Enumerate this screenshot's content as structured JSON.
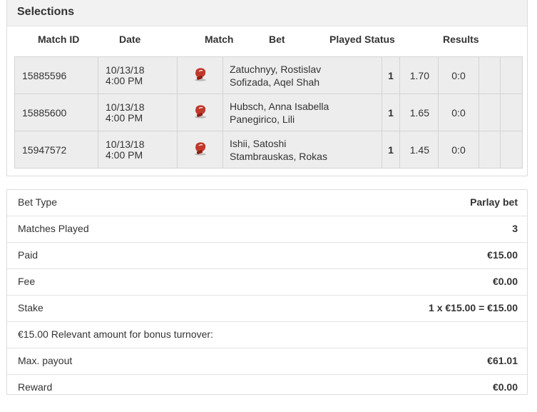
{
  "selections": {
    "title": "Selections",
    "headers": {
      "match_id": "Match ID",
      "date": "Date",
      "match": "Match",
      "bet": "Bet",
      "played_status": "Played Status",
      "results": "Results"
    },
    "rows": [
      {
        "id": "15885596",
        "date": "10/13/18",
        "time": "4:00 PM",
        "sport_icon": "boxing-glove-icon",
        "player1": "Zatuchnyy, Rostislav",
        "player2": "Sofizada, Aqel Shah",
        "bet": "1",
        "odds": "1.70",
        "result": "0:0"
      },
      {
        "id": "15885600",
        "date": "10/13/18",
        "time": "4:00 PM",
        "sport_icon": "boxing-glove-icon",
        "player1": "Hubsch, Anna Isabella",
        "player2": "Panegirico, Lili",
        "bet": "1",
        "odds": "1.65",
        "result": "0:0"
      },
      {
        "id": "15947572",
        "date": "10/13/18",
        "time": "4:00 PM",
        "sport_icon": "boxing-glove-icon",
        "player1": "Ishii, Satoshi",
        "player2": "Stambrauskas, Rokas",
        "bet": "1",
        "odds": "1.45",
        "result": "0:0"
      }
    ]
  },
  "summary": [
    {
      "label": "Bet Type",
      "value": "Parlay bet"
    },
    {
      "label": "Matches Played",
      "value": "3"
    },
    {
      "label": "Paid",
      "value": "€15.00"
    },
    {
      "label": "Fee",
      "value": "€0.00"
    },
    {
      "label": "Stake",
      "value": "1 x €15.00 = €15.00"
    },
    {
      "label": "€15.00 Relevant amount for bonus turnover:",
      "value": ""
    },
    {
      "label": "Max. payout",
      "value": "€61.01"
    },
    {
      "label": "Reward",
      "value": "€0.00"
    }
  ],
  "colors": {
    "glove": "#c0392b",
    "header_bg": "#f2f2f2",
    "row_bg": "#ededed"
  }
}
